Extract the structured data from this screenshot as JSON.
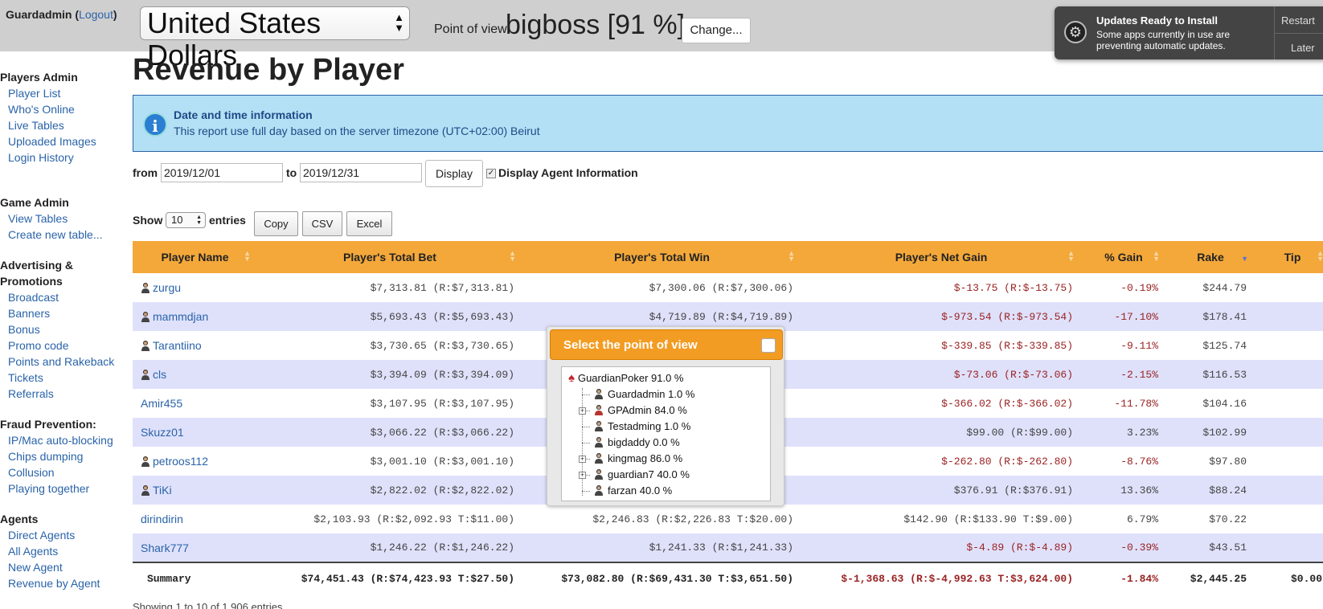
{
  "header": {
    "user": "Guardadmin",
    "logout": "Logout",
    "currency": "United States Dollars",
    "pov_label": "Point of view:",
    "pov_value": "bigboss [91 %]",
    "change_button": "Change..."
  },
  "notification": {
    "title": "Updates Ready to Install",
    "text": "Some apps currently in use are preventing automatic updates.",
    "restart": "Restart",
    "later": "Later"
  },
  "sidebar": {
    "sections": [
      {
        "heading": "Players Admin",
        "items": [
          "Player List",
          "Who's Online",
          "Live Tables",
          "Uploaded Images",
          "Login History"
        ]
      },
      {
        "heading": "Game Admin",
        "items": [
          "View Tables",
          "Create new table..."
        ]
      },
      {
        "heading": "Advertising & Promotions",
        "items": [
          "Broadcast",
          "Banners",
          "Bonus",
          "Promo code",
          "Points and Rakeback",
          "Tickets",
          "Referrals"
        ]
      },
      {
        "heading": "Fraud Prevention:",
        "items": [
          "IP/Mac auto-blocking",
          "Chips dumping",
          "Collusion",
          "Playing together"
        ]
      },
      {
        "heading": "Agents",
        "items": [
          "Direct Agents",
          "All Agents",
          "New Agent",
          "Revenue by Agent"
        ]
      }
    ]
  },
  "main": {
    "title": "Revenue by Player",
    "info_title": "Date and time information",
    "info_text": "This report use full day based on the server timezone (UTC+02:00) Beirut",
    "from_label": "from",
    "from_value": "2019/12/01",
    "to_label": "to",
    "to_value": "2019/12/31",
    "display_button": "Display",
    "agent_info_label": "Display Agent Information",
    "show_label": "Show",
    "entries_value": "10",
    "entries_label": "entries",
    "copy": "Copy",
    "csv": "CSV",
    "excel": "Excel",
    "footer": "Showing 1 to 10 of 1,906 entries"
  },
  "table": {
    "columns": [
      "Player Name",
      "Player's Total Bet",
      "Player's Total Win",
      "Player's Net Gain",
      "% Gain",
      "Rake",
      "Tip"
    ],
    "rows": [
      {
        "name": "zurgu",
        "avatar": true,
        "bet": "$7,313.81 (R:$7,313.81)",
        "win": "$7,300.06 (R:$7,300.06)",
        "net": "$-13.75 (R:$-13.75)",
        "neg": true,
        "gain": "-0.19%",
        "rake": "$244.79",
        "tip": ""
      },
      {
        "name": "mammdjan",
        "avatar": true,
        "bet": "$5,693.43 (R:$5,693.43)",
        "win": "$4,719.89 (R:$4,719.89)",
        "net": "$-973.54 (R:$-973.54)",
        "neg": true,
        "gain": "-17.10%",
        "rake": "$178.41",
        "tip": ""
      },
      {
        "name": "Tarantiino",
        "avatar": true,
        "bet": "$3,730.65 (R:$3,730.65)",
        "win": "",
        "net": "$-339.85 (R:$-339.85)",
        "neg": true,
        "gain": "-9.11%",
        "rake": "$125.74",
        "tip": ""
      },
      {
        "name": "cls",
        "avatar": true,
        "bet": "$3,394.09 (R:$3,394.09)",
        "win": "",
        "net": "$-73.06 (R:$-73.06)",
        "neg": true,
        "gain": "-2.15%",
        "rake": "$116.53",
        "tip": ""
      },
      {
        "name": "Amir455",
        "avatar": false,
        "bet": "$3,107.95 (R:$3,107.95)",
        "win": "",
        "net": "$-366.02 (R:$-366.02)",
        "neg": true,
        "gain": "-11.78%",
        "rake": "$104.16",
        "tip": ""
      },
      {
        "name": "Skuzz01",
        "avatar": false,
        "bet": "$3,066.22 (R:$3,066.22)",
        "win": "",
        "net": "$99.00 (R:$99.00)",
        "neg": false,
        "gain": "3.23%",
        "rake": "$102.99",
        "tip": ""
      },
      {
        "name": "petroos112",
        "avatar": true,
        "bet": "$3,001.10 (R:$3,001.10)",
        "win": "",
        "net": "$-262.80 (R:$-262.80)",
        "neg": true,
        "gain": "-8.76%",
        "rake": "$97.80",
        "tip": ""
      },
      {
        "name": "TiKi",
        "avatar": true,
        "bet": "$2,822.02 (R:$2,822.02)",
        "win": "",
        "net": "$376.91 (R:$376.91)",
        "neg": false,
        "gain": "13.36%",
        "rake": "$88.24",
        "tip": ""
      },
      {
        "name": "dirindirin",
        "avatar": false,
        "bet": "$2,103.93 (R:$2,092.93 T:$11.00)",
        "win": "$2,246.83 (R:$2,226.83 T:$20.00)",
        "net": "$142.90 (R:$133.90 T:$9.00)",
        "neg": false,
        "gain": "6.79%",
        "rake": "$70.22",
        "tip": ""
      },
      {
        "name": "Shark777",
        "avatar": false,
        "bet": "$1,246.22 (R:$1,246.22)",
        "win": "$1,241.33 (R:$1,241.33)",
        "net": "$-4.89 (R:$-4.89)",
        "neg": true,
        "gain": "-0.39%",
        "rake": "$43.51",
        "tip": ""
      }
    ],
    "summary": {
      "label": "Summary",
      "bet": "$74,451.43 (R:$74,423.93 T:$27.50)",
      "win": "$73,082.80 (R:$69,431.30 T:$3,651.50)",
      "net": "$-1,368.63 (R:$-4,992.63 T:$3,624.00)",
      "gain": "-1.84%",
      "rake": "$2,445.25",
      "tip": "$0.00"
    }
  },
  "pov_popup": {
    "title": "Select the point of view",
    "nodes": [
      {
        "label": "GuardianPoker 91.0 %",
        "root": true,
        "expand": false
      },
      {
        "label": "Guardadmin 1.0 %",
        "root": false,
        "expand": false
      },
      {
        "label": "GPAdmin 84.0 %",
        "root": false,
        "expand": true
      },
      {
        "label": "Testadming 1.0 %",
        "root": false,
        "expand": false
      },
      {
        "label": "bigdaddy 0.0 %",
        "root": false,
        "expand": false
      },
      {
        "label": "kingmag 86.0 %",
        "root": false,
        "expand": true
      },
      {
        "label": "guardian7 40.0 %",
        "root": false,
        "expand": true
      },
      {
        "label": "farzan 40.0 %",
        "root": false,
        "expand": false
      }
    ]
  },
  "colors": {
    "accent": "#f4a83a",
    "info_bg": "#b3e0f5",
    "row_alt": "#dfe1fb",
    "negative": "#9a2222",
    "link": "#2a63a8"
  }
}
